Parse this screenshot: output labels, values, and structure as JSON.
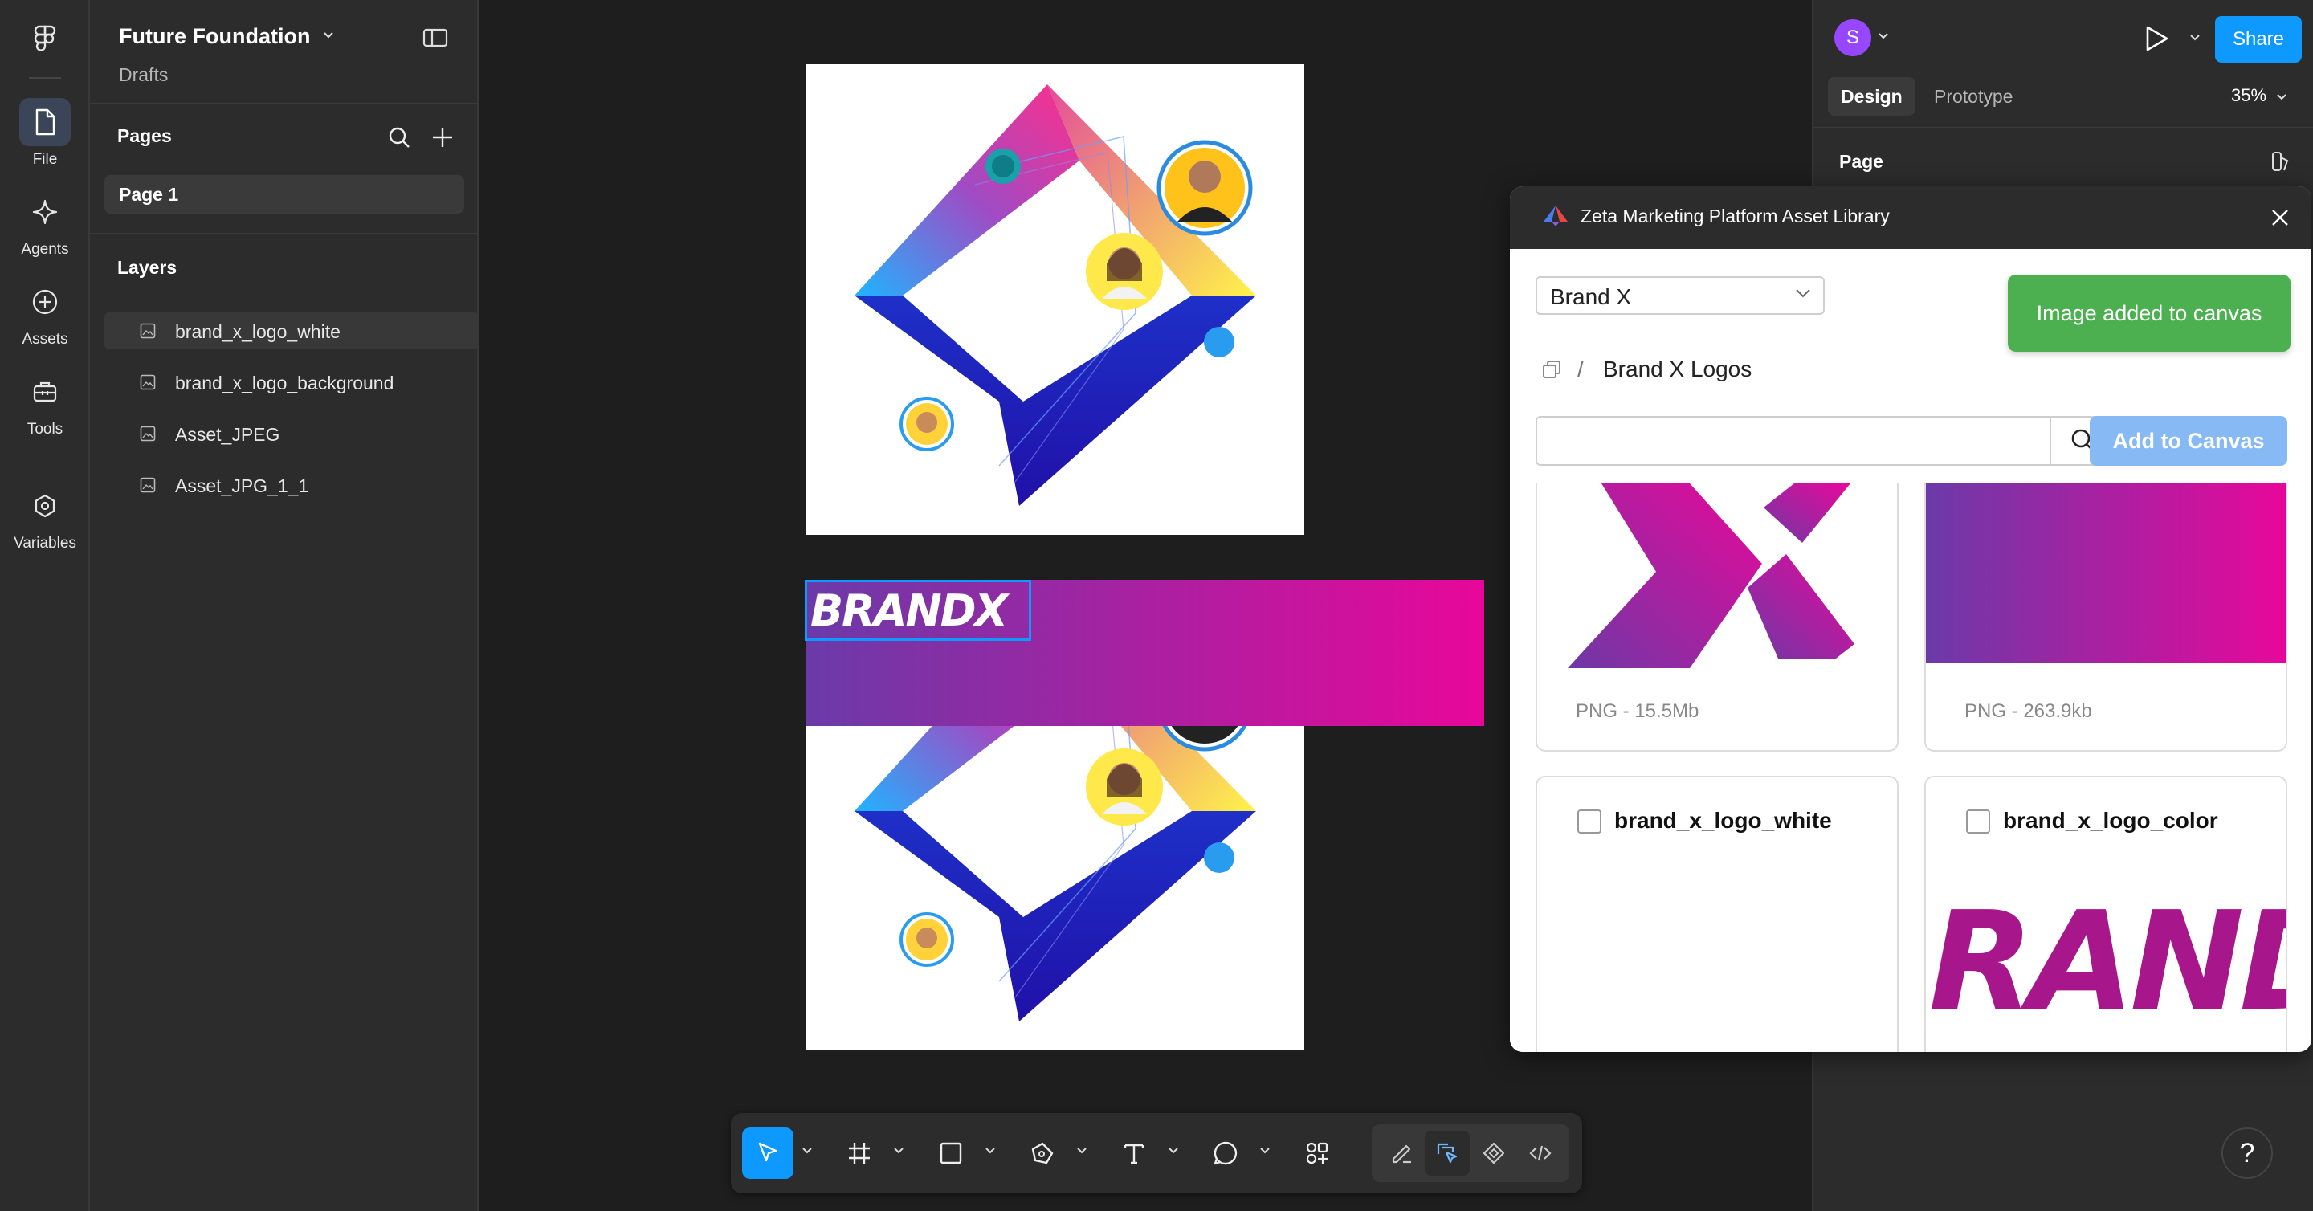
{
  "rail": {
    "items": [
      {
        "label": "File",
        "icon": "file-icon"
      },
      {
        "label": "Agents",
        "icon": "sparkle-icon"
      },
      {
        "label": "Assets",
        "icon": "plus-circle-icon"
      },
      {
        "label": "Tools",
        "icon": "toolbox-icon"
      },
      {
        "label": "Variables",
        "icon": "hexagon-icon"
      }
    ]
  },
  "file": {
    "title": "Future Foundation",
    "subtitle": "Drafts"
  },
  "pages": {
    "title": "Pages",
    "items": [
      "Page 1"
    ]
  },
  "layers": {
    "title": "Layers",
    "items": [
      "brand_x_logo_white",
      "brand_x_logo_background",
      "Asset_JPEG",
      "Asset_JPG_1_1"
    ]
  },
  "canvas": {
    "banner_logo_text": "BRANDX"
  },
  "header": {
    "avatar_initial": "S",
    "share_label": "Share"
  },
  "design_tabs": {
    "design": "Design",
    "prototype": "Prototype",
    "zoom": "35%"
  },
  "right_panel": {
    "section_page": "Page"
  },
  "plugin": {
    "title": "Zeta Marketing Platform Asset Library",
    "brand_select": "Brand X",
    "toast": "Image added to canvas",
    "breadcrumb_sep": "/",
    "breadcrumb": "Brand X Logos",
    "search_value": "",
    "add_button": "Add to Canvas",
    "cards": [
      {
        "meta": "PNG  -  15.5Mb"
      },
      {
        "meta": "PNG  -  263.9kb"
      },
      {
        "title": "brand_x_logo_white"
      },
      {
        "title": "brand_x_logo_color"
      }
    ],
    "card_preview_text": "BRANDX"
  },
  "help": {
    "label": "?"
  },
  "colors": {
    "accent": "#0d99ff",
    "toast": "#4caf50",
    "brand_purple": "#7b3aa8",
    "brand_magenta": "#e4079a",
    "add_button": "#87b9f5"
  }
}
